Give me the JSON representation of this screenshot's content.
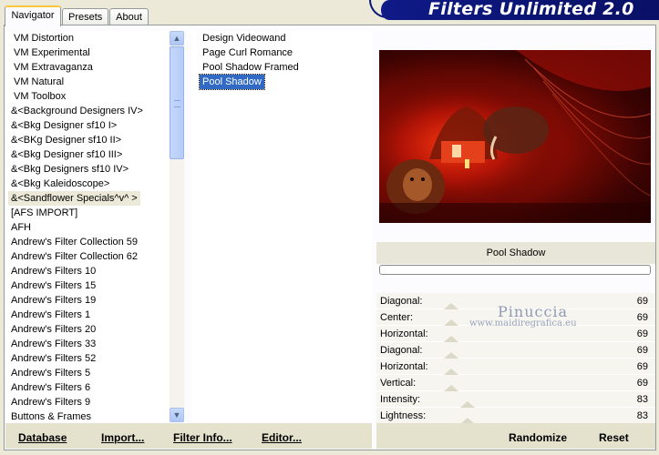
{
  "tabs": [
    {
      "label": "Navigator",
      "active": true
    },
    {
      "label": "Presets",
      "active": false
    },
    {
      "label": "About",
      "active": false
    }
  ],
  "banner": {
    "title": "Filters Unlimited 2.0"
  },
  "categories": {
    "items": [
      "VM Distortion",
      "VM Experimental",
      "VM Extravaganza",
      "VM Natural",
      "VM Toolbox",
      "&<Background Designers IV>",
      "&<Bkg Designer sf10 I>",
      "&<BKg Designer sf10 II>",
      "&<Bkg Designer sf10 III>",
      "&<Bkg Designers sf10 IV>",
      "&<Bkg Kaleidoscope>",
      "&<Sandflower Specials^v^ >",
      "[AFS IMPORT]",
      "AFH",
      "Andrew's Filter Collection 59",
      "Andrew's Filter Collection 62",
      "Andrew's Filters 10",
      "Andrew's Filters 15",
      "Andrew's Filters 19",
      "Andrew's Filters 1",
      "Andrew's Filters 20",
      "Andrew's Filters 33",
      "Andrew's Filters 52",
      "Andrew's Filters 5",
      "Andrew's Filters 6",
      "Andrew's Filters 9",
      "Buttons & Frames"
    ],
    "selected": "&<Sandflower Specials^v^ >"
  },
  "filters": {
    "items": [
      "Design Videowand",
      "Page Curl Romance",
      "Pool Shadow Framed",
      "Pool Shadow"
    ],
    "selected": "Pool Shadow"
  },
  "preview": {
    "filter_name": "Pool Shadow"
  },
  "sliders": [
    {
      "label": "Diagonal:",
      "value": "69"
    },
    {
      "label": "Center:",
      "value": "69"
    },
    {
      "label": "Horizontal:",
      "value": "69"
    },
    {
      "label": "Diagonal:",
      "value": "69"
    },
    {
      "label": "Horizontal:",
      "value": "69"
    },
    {
      "label": "Vertical:",
      "value": "69"
    },
    {
      "label": "Intensity:",
      "value": "83"
    },
    {
      "label": "Lightness:",
      "value": "83"
    }
  ],
  "watermark": {
    "title": "Pinuccia",
    "url": "www.maidiregrafica.eu"
  },
  "buttons": {
    "database": "Database",
    "import": "Import...",
    "filter_info": "Filter Info...",
    "editor": "Editor...",
    "randomize": "Randomize",
    "reset": "Reset"
  },
  "colors": {
    "banner": "#0a1470",
    "selection": "#316ac5",
    "window": "#ece9d8"
  }
}
